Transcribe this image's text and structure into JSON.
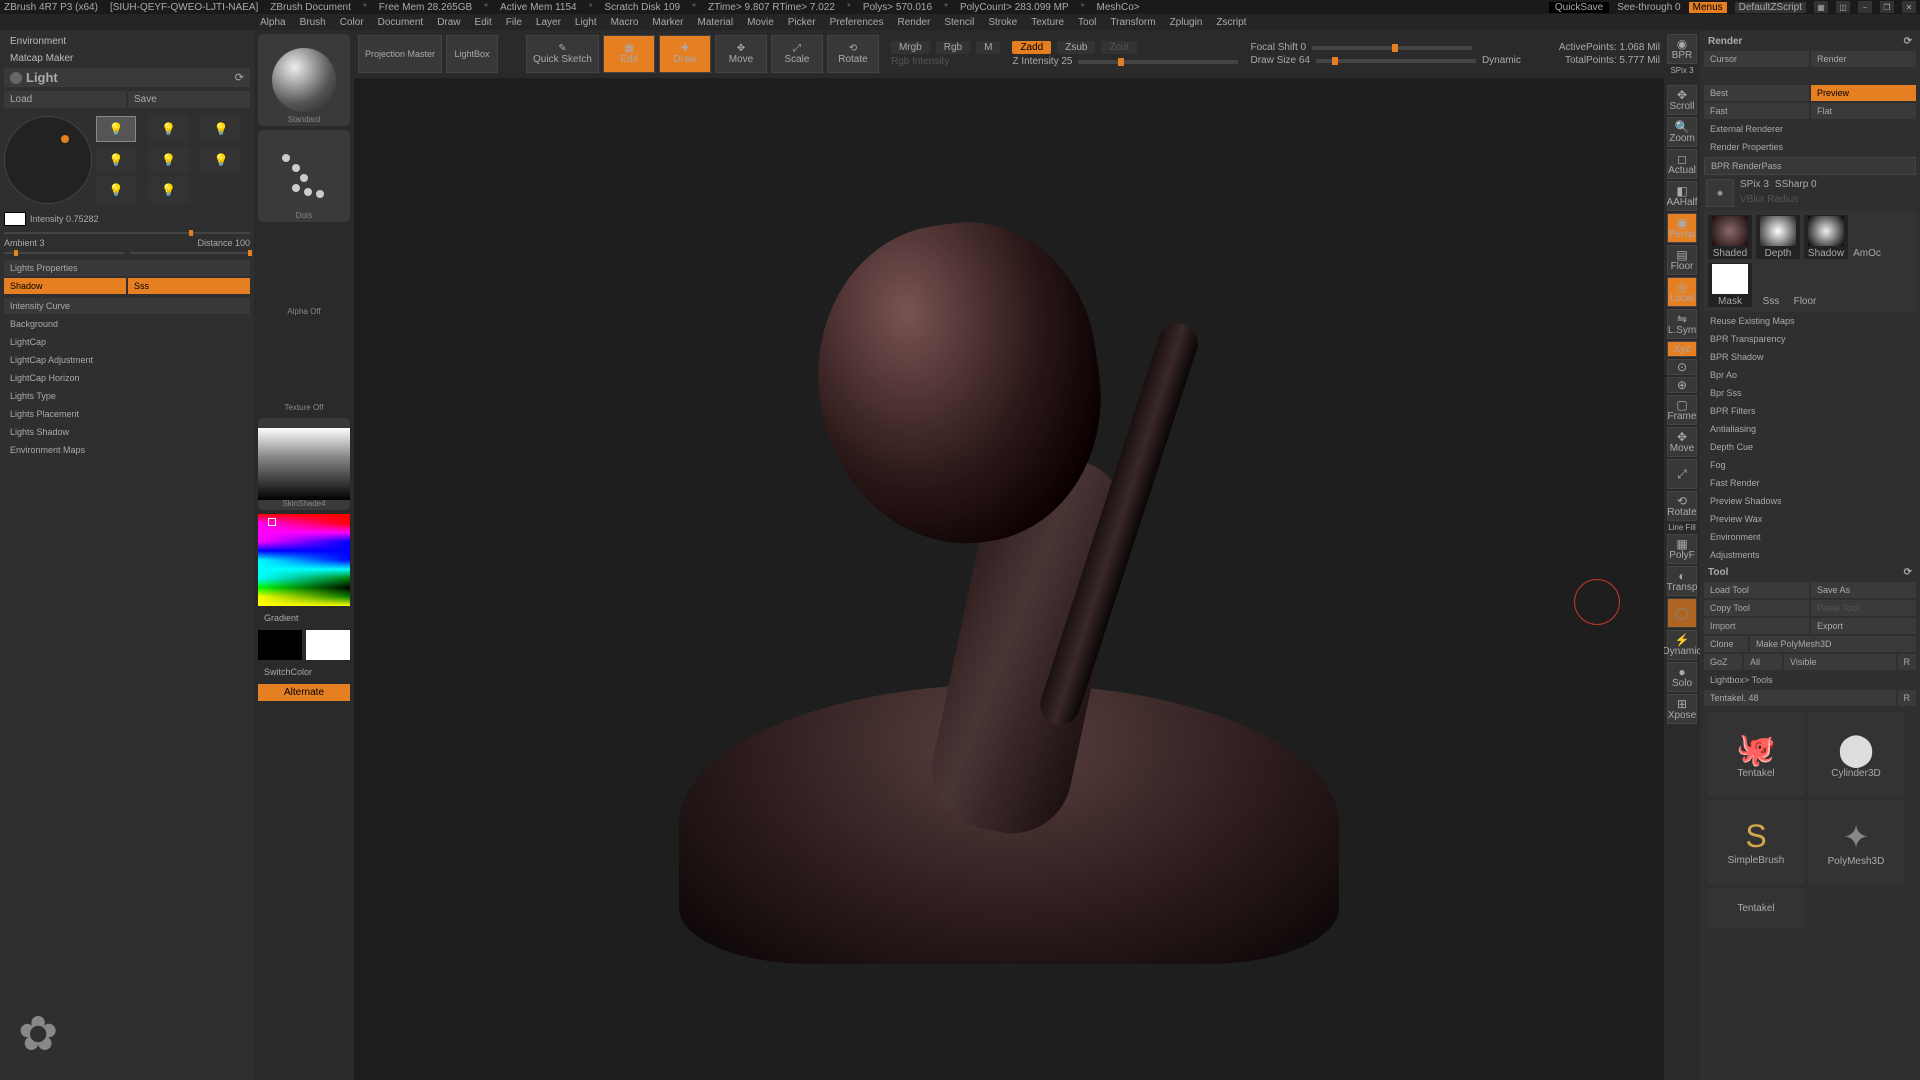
{
  "title": {
    "app": "ZBrush 4R7 P3 (x64)",
    "file": "[SIUH-QEYF-QWEO-LJTI-NAEA]",
    "doc": "ZBrush Document",
    "mem_free": "Free Mem 28.265GB",
    "mem_active": "Active Mem 1154",
    "scratch": "Scratch Disk 109",
    "ztime": "ZTime> 9.807 RTime> 7.022",
    "polys": "Polys> 570.016",
    "polycount": "PolyCount> 283.099 MP",
    "meshcount": "MeshCo>",
    "quicksave": "QuickSave",
    "seethrough": "See-through 0",
    "menus": "Menus",
    "zscript": "DefaultZScript"
  },
  "menubar": [
    "Alpha",
    "Brush",
    "Color",
    "Document",
    "Draw",
    "Edit",
    "File",
    "Layer",
    "Light",
    "Macro",
    "Marker",
    "Material",
    "Movie",
    "Picker",
    "Preferences",
    "Render",
    "Stencil",
    "Stroke",
    "Texture",
    "Tool",
    "Transform",
    "Zplugin",
    "Zscript"
  ],
  "left": {
    "environment": "Environment",
    "matcap": "Matcap Maker",
    "light": "Light",
    "load": "Load",
    "save": "Save",
    "intensity_label": "Intensity 0.75282",
    "ambient_label": "Ambient 3",
    "distance_label": "Distance 100",
    "lights_props": "Lights Properties",
    "shadow": "Shadow",
    "sss": "Sss",
    "int_curve": "Intensity Curve",
    "sections": [
      "Background",
      "LightCap",
      "LightCap Adjustment",
      "LightCap Horizon",
      "Lights Type",
      "Lights Placement",
      "Lights Shadow",
      "Environment Maps"
    ]
  },
  "strip": {
    "standard": "Standard",
    "dots": "Dots",
    "alpha_off": "Alpha Off",
    "texture_off": "Texture Off",
    "skinshade": "SkinShade4",
    "gradient": "Gradient",
    "switch": "SwitchColor",
    "alternate": "Alternate"
  },
  "top": {
    "projection": "Projection Master",
    "lightbox": "LightBox",
    "quicksketch": "Quick Sketch",
    "edit": "Edit",
    "draw": "Draw",
    "move": "Move",
    "scale": "Scale",
    "rotate": "Rotate",
    "mrgb": "Mrgb",
    "rgb": "Rgb",
    "m": "M",
    "rgb_int": "Rgb Intensity",
    "zadd": "Zadd",
    "zsub": "Zsub",
    "zcut": "Zcut",
    "zint": "Z Intensity 25",
    "focal": "Focal Shift 0",
    "drawsize": "Draw Size 64",
    "dynamic": "Dynamic",
    "active": "ActivePoints: 1.068 Mil",
    "total": "TotalPoints: 5.777 Mil"
  },
  "rstrip": {
    "bpr": "BPR",
    "spix": "SPix 3",
    "items": [
      "Scroll",
      "Zoom",
      "Actual",
      "AAHalf",
      "Persp",
      "Floor",
      "Local",
      "L.Sym",
      "Xyz",
      "",
      "",
      "Frame",
      "Move",
      "",
      "Rotate",
      "Line Fill",
      "PolyF",
      "Transp",
      "",
      "Dynamic",
      "Solo",
      "Xpose"
    ]
  },
  "right": {
    "render": "Render",
    "cursor": "Cursor",
    "render_tab": "Render",
    "best": "Best",
    "preview": "Preview",
    "fast_l": "Fast",
    "flat": "Flat",
    "ext": "External Renderer",
    "props": "Render Properties",
    "bpr_rp": "BPR RenderPass",
    "spix": "SPix 3",
    "ssharp": "SSharp 0",
    "vblur": "VBlur Radius",
    "passes": [
      "Shaded",
      "Depth",
      "Shadow",
      "AmOc",
      "Mask",
      "Sss",
      "Floor"
    ],
    "reuse": "Reuse Existing Maps",
    "sections": [
      "BPR Transparency",
      "BPR Shadow",
      "Bpr Ao",
      "Bpr Sss",
      "BPR Filters",
      "Antialiasing",
      "Depth Cue",
      "Fog",
      "Fast Render",
      "Preview Shadows",
      "Preview Wax",
      "Environment",
      "Adjustments"
    ],
    "tool": "Tool",
    "load_tool": "Load Tool",
    "save_as": "Save As",
    "copy_tool": "Copy Tool",
    "paste_tool": "Paste Tool",
    "import": "Import",
    "export": "Export",
    "clone": "Clone",
    "make_pm": "Make PolyMesh3D",
    "goz": "GoZ",
    "all": "All",
    "visible": "Visible",
    "r": "R",
    "lb_tools": "Lightbox> Tools",
    "current": "Tentakel. 48",
    "tools": [
      "Tentakel",
      "Cylinder3D",
      "SimpleBrush",
      "PolyMesh3D",
      "Tentakel"
    ]
  }
}
